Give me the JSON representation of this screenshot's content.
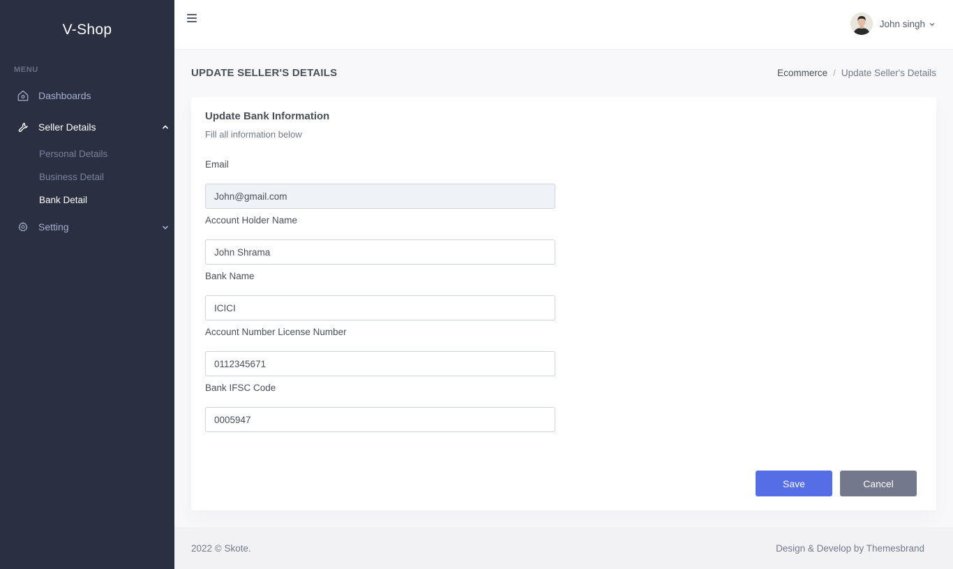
{
  "sidebar": {
    "brand": "V-Shop",
    "menu_title": "MENU",
    "items": [
      {
        "label": "Dashboards",
        "icon": "home-icon"
      },
      {
        "label": "Seller Details",
        "icon": "wrench-icon",
        "expanded": true,
        "children": [
          "Personal Details",
          "Business Detail",
          "Bank Detail"
        ]
      },
      {
        "label": "Setting",
        "icon": "gear-icon",
        "expanded": false
      }
    ]
  },
  "topbar": {
    "user_name": "John singh"
  },
  "page": {
    "title": "UPDATE SELLER'S DETAILS",
    "breadcrumb": [
      "Ecommerce",
      "Update Seller's Details"
    ]
  },
  "form": {
    "title": "Update Bank Information",
    "description": "Fill all information below",
    "fields": [
      {
        "label": "Email",
        "value": "John@gmail.com"
      },
      {
        "label": "Account Holder Name",
        "value": "John Shrama"
      },
      {
        "label": "Bank Name",
        "value": "ICICI"
      },
      {
        "label": "Account Number License Number",
        "value": "0112345671"
      },
      {
        "label": "Bank IFSC Code",
        "value": "0005947"
      }
    ],
    "save_label": "Save",
    "cancel_label": "Cancel"
  },
  "footer": {
    "left": "2022 © Skote.",
    "right": "Design & Develop by Themesbrand"
  },
  "colors": {
    "sidebar_bg": "#2a3042",
    "primary": "#556ee6",
    "secondary": "#74788d",
    "readonly_bg": "#eff2f7"
  }
}
